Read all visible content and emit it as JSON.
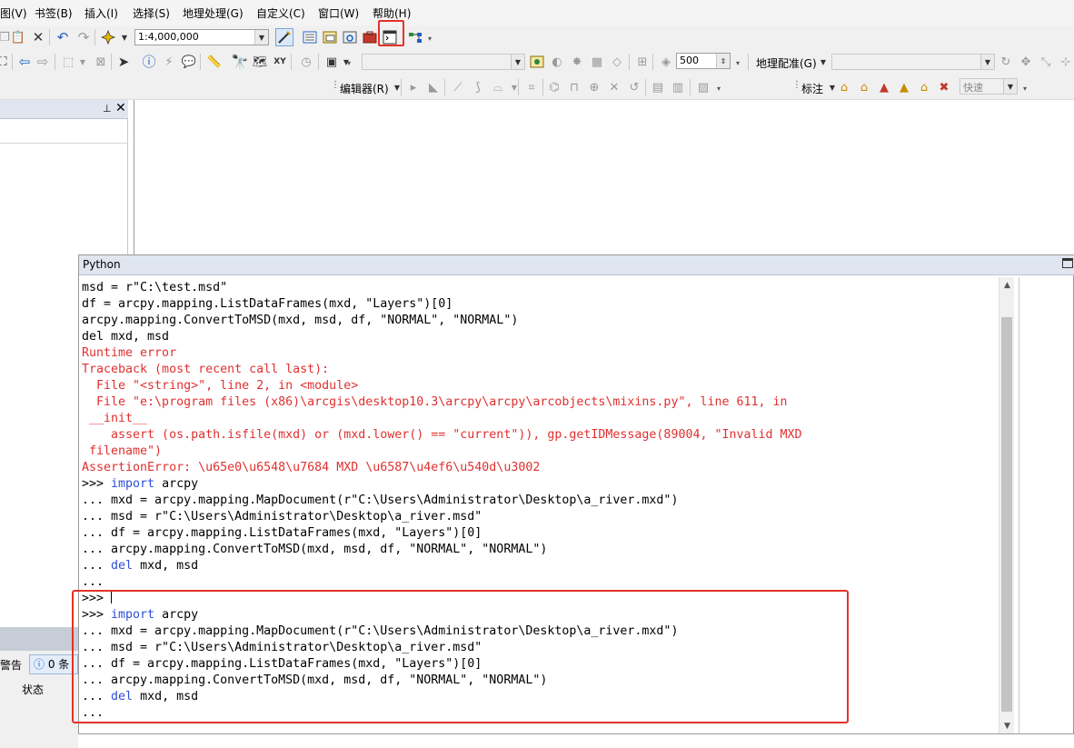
{
  "menubar": {
    "items": [
      "图(V)",
      "书签(B)",
      "插入(I)",
      "选择(S)",
      "地理处理(G)",
      "自定义(C)",
      "窗口(W)",
      "帮助(H)"
    ]
  },
  "toolbar_standard": {
    "scale_value": "1:4,000,000",
    "icons": [
      "copy-icon",
      "paste-icon",
      "delete-icon",
      "undo-icon",
      "redo-icon",
      "add-data-icon",
      "editor-toolbar-icon",
      "table-of-contents-icon",
      "catalog-icon",
      "search-icon",
      "arctoolbox-icon",
      "python-window-icon",
      "model-builder-icon"
    ]
  },
  "toolbar_tools": {
    "layer_value": "",
    "number_value": "500",
    "georef_label": "地理配准(G)",
    "georef_layer_value": ""
  },
  "toolbar_editor": {
    "editor_label": "编辑器(R)",
    "label_label": "标注",
    "speed_value": "快速"
  },
  "toc": {
    "pin_glyph": "📌",
    "close_glyph": "✕"
  },
  "bottom_panel": {
    "warn_label": "警告",
    "info_label": "0 条",
    "status_label": "状态"
  },
  "python_window": {
    "title": "Python",
    "lines": [
      {
        "text": "msd = r\"C:\\test.msd\"",
        "style": "normal"
      },
      {
        "text": "df = arcpy.mapping.ListDataFrames(mxd, \"Layers\")[0]",
        "style": "normal"
      },
      {
        "text": "arcpy.mapping.ConvertToMSD(mxd, msd, df, \"NORMAL\", \"NORMAL\")",
        "style": "normal"
      },
      {
        "text": "del mxd, msd",
        "style": "normal"
      },
      {
        "text": "Runtime error",
        "style": "err"
      },
      {
        "text": "Traceback (most recent call last):",
        "style": "err"
      },
      {
        "text": "  File \"<string>\", line 2, in <module>",
        "style": "err"
      },
      {
        "text": "  File \"e:\\program files (x86)\\arcgis\\desktop10.3\\arcpy\\arcpy\\arcobjects\\mixins.py\", line 611, in",
        "style": "err"
      },
      {
        "text": " __init__",
        "style": "err"
      },
      {
        "text": "    assert (os.path.isfile(mxd) or (mxd.lower() == \"current\")), gp.getIDMessage(89004, \"Invalid MXD",
        "style": "err"
      },
      {
        "text": " filename\")",
        "style": "err"
      },
      {
        "text": "AssertionError: \\u65e0\\u6548\\u7684 MXD \\u6587\\u4ef6\\u540d\\u3002",
        "style": "err"
      },
      {
        "text": ">>> import arcpy",
        "style": "kw",
        "prefix": ">>> ",
        "kw": "import",
        "rest": " arcpy"
      },
      {
        "text": "... mxd = arcpy.mapping.MapDocument(r\"C:\\Users\\Administrator\\Desktop\\a_river.mxd\")",
        "style": "normal"
      },
      {
        "text": "... msd = r\"C:\\Users\\Administrator\\Desktop\\a_river.msd\"",
        "style": "normal"
      },
      {
        "text": "... df = arcpy.mapping.ListDataFrames(mxd, \"Layers\")[0]",
        "style": "normal"
      },
      {
        "text": "... arcpy.mapping.ConvertToMSD(mxd, msd, df, \"NORMAL\", \"NORMAL\")",
        "style": "normal"
      },
      {
        "text": "... del mxd, msd",
        "style": "kw",
        "prefix": "... ",
        "kw": "del",
        "rest": " mxd, msd"
      },
      {
        "text": "...",
        "style": "normal"
      },
      {
        "text": ">>> ",
        "style": "cursor"
      },
      {
        "text": ">>> import arcpy",
        "style": "kw",
        "prefix": ">>> ",
        "kw": "import",
        "rest": " arcpy"
      },
      {
        "text": "... mxd = arcpy.mapping.MapDocument(r\"C:\\Users\\Administrator\\Desktop\\a_river.mxd\")",
        "style": "normal"
      },
      {
        "text": "... msd = r\"C:\\Users\\Administrator\\Desktop\\a_river.msd\"",
        "style": "normal"
      },
      {
        "text": "... df = arcpy.mapping.ListDataFrames(mxd, \"Layers\")[0]",
        "style": "normal"
      },
      {
        "text": "... arcpy.mapping.ConvertToMSD(mxd, msd, df, \"NORMAL\", \"NORMAL\")",
        "style": "normal"
      },
      {
        "text": "... del mxd, msd",
        "style": "kw",
        "prefix": "... ",
        "kw": "del",
        "rest": " mxd, msd"
      },
      {
        "text": "...",
        "style": "normal"
      }
    ]
  },
  "colors": {
    "error_text": "#e03030",
    "keyword": "#2e4fd8",
    "highlight_frame": "#e5312b"
  }
}
